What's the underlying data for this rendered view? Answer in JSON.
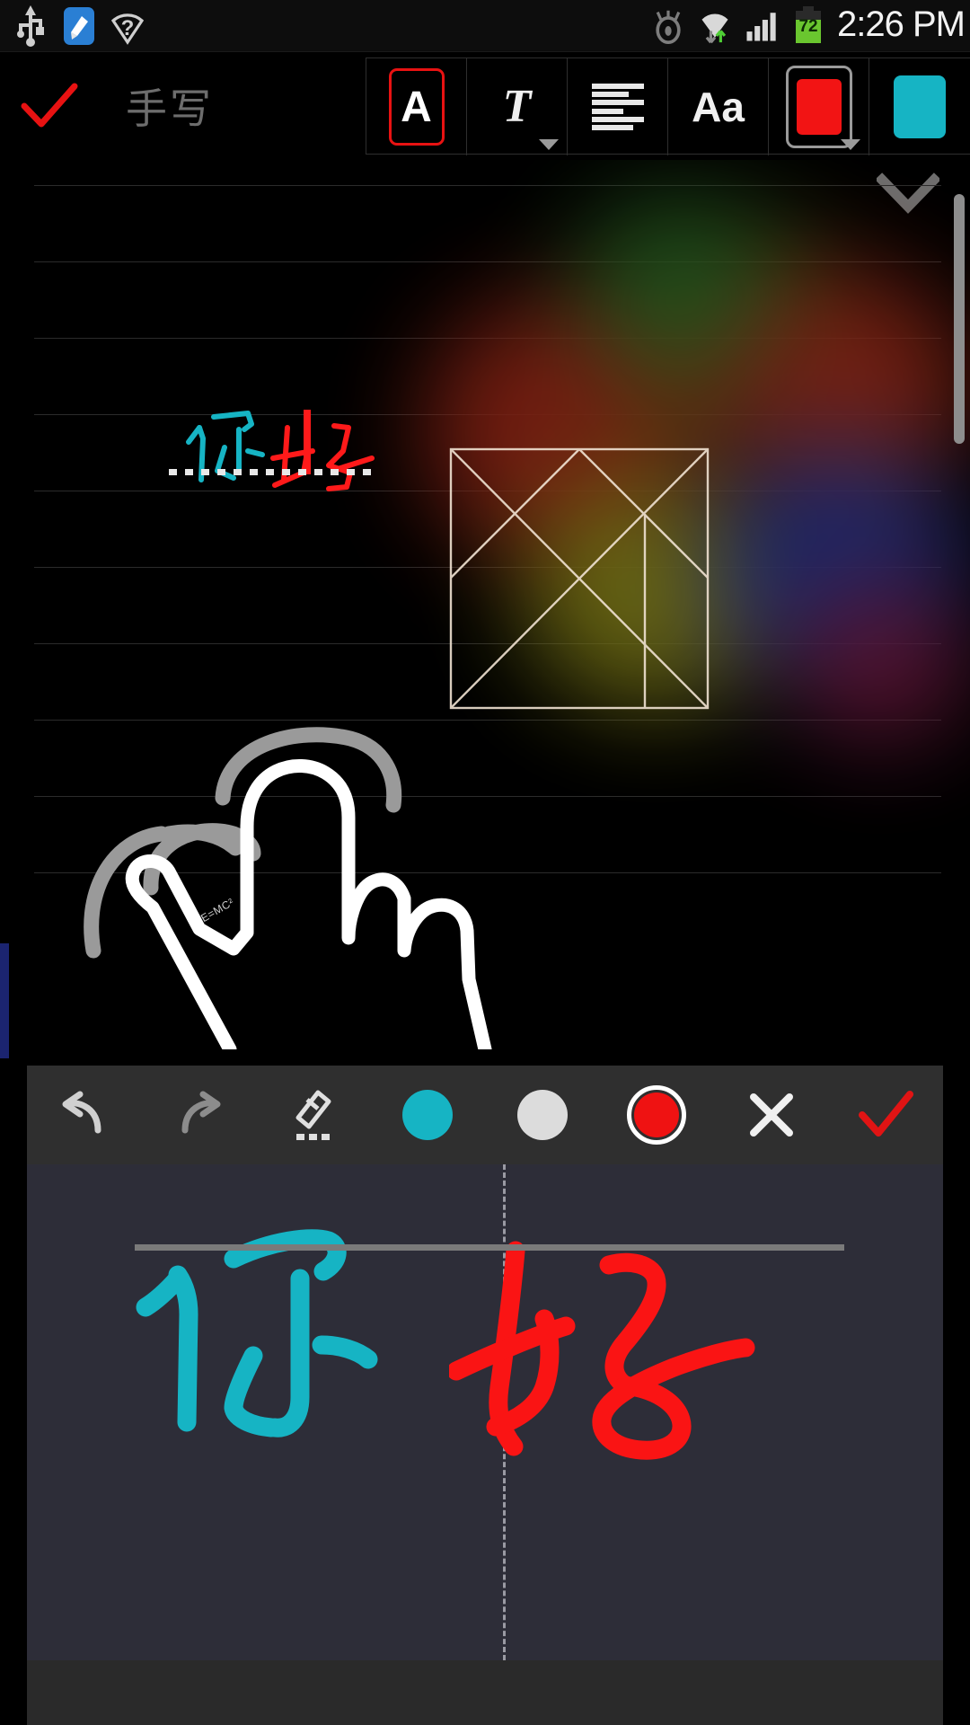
{
  "status_bar": {
    "time": "2:26 PM",
    "battery_percent": "72",
    "icons": [
      "usb-icon",
      "app-cleaner-icon",
      "wifi-question-icon",
      "eye-icon",
      "wifi-signal-icon",
      "cell-signal-icon",
      "battery-icon"
    ]
  },
  "top_toolbar": {
    "confirm_label": "✓",
    "mode_label": "手写",
    "buttons": [
      {
        "name": "text-style-button",
        "glyph": "A",
        "selected": true,
        "has_caret": false
      },
      {
        "name": "text-format-button",
        "glyph": "T",
        "selected": false,
        "has_caret": true
      },
      {
        "name": "align-button",
        "glyph": "≡",
        "selected": false,
        "has_caret": false
      },
      {
        "name": "font-size-button",
        "glyph": "Aa",
        "selected": false,
        "has_caret": false
      },
      {
        "name": "text-color-button",
        "glyph": "",
        "selected": false,
        "has_caret": true,
        "color": "#f21414"
      },
      {
        "name": "highlight-color-button",
        "glyph": "",
        "selected": false,
        "has_caret": false,
        "color": "#16b4c4"
      }
    ]
  },
  "note_canvas": {
    "collapse_icon": "chevron-down-icon",
    "preview_text": "你好",
    "preview_colors": {
      "first_char": "#16b4c4",
      "second_char": "#ff1a1a"
    },
    "caret_color": "#ff1a1a",
    "annotation_text": "E=MC²",
    "ruled_line_color": "#2b2b2b",
    "left_marker_color": "#1b2470",
    "glow_colors": [
      "#7a1f12",
      "#6d6a14",
      "#1f2a6e",
      "#2a5a20",
      "#6b1a3a"
    ],
    "shape_name": "tangram-square-drawing",
    "hand_drawing_name": "pointing-hand-drawing"
  },
  "handwriting_panel": {
    "background": "#2d2d38",
    "tools": [
      {
        "name": "undo-button",
        "icon": "undo-icon"
      },
      {
        "name": "redo-button",
        "icon": "redo-icon"
      },
      {
        "name": "eraser-button",
        "icon": "eraser-icon"
      },
      {
        "name": "color-cyan-button",
        "icon": "color-dot-icon",
        "color": "#16b4c4",
        "selected": false
      },
      {
        "name": "color-white-button",
        "icon": "color-dot-icon",
        "color": "#dcdcdc",
        "selected": false
      },
      {
        "name": "color-red-button",
        "icon": "color-dot-icon",
        "color": "#ef1212",
        "selected": true
      },
      {
        "name": "cancel-button",
        "icon": "close-icon"
      },
      {
        "name": "confirm-button",
        "icon": "check-icon",
        "color": "#e01414"
      }
    ],
    "ink_text": "你好",
    "ink_colors": {
      "first_char": "#16b4c4",
      "second_char": "#fa1414"
    },
    "baseline_color": "#7a7a7a",
    "divider_color": "#9a9aa3"
  }
}
